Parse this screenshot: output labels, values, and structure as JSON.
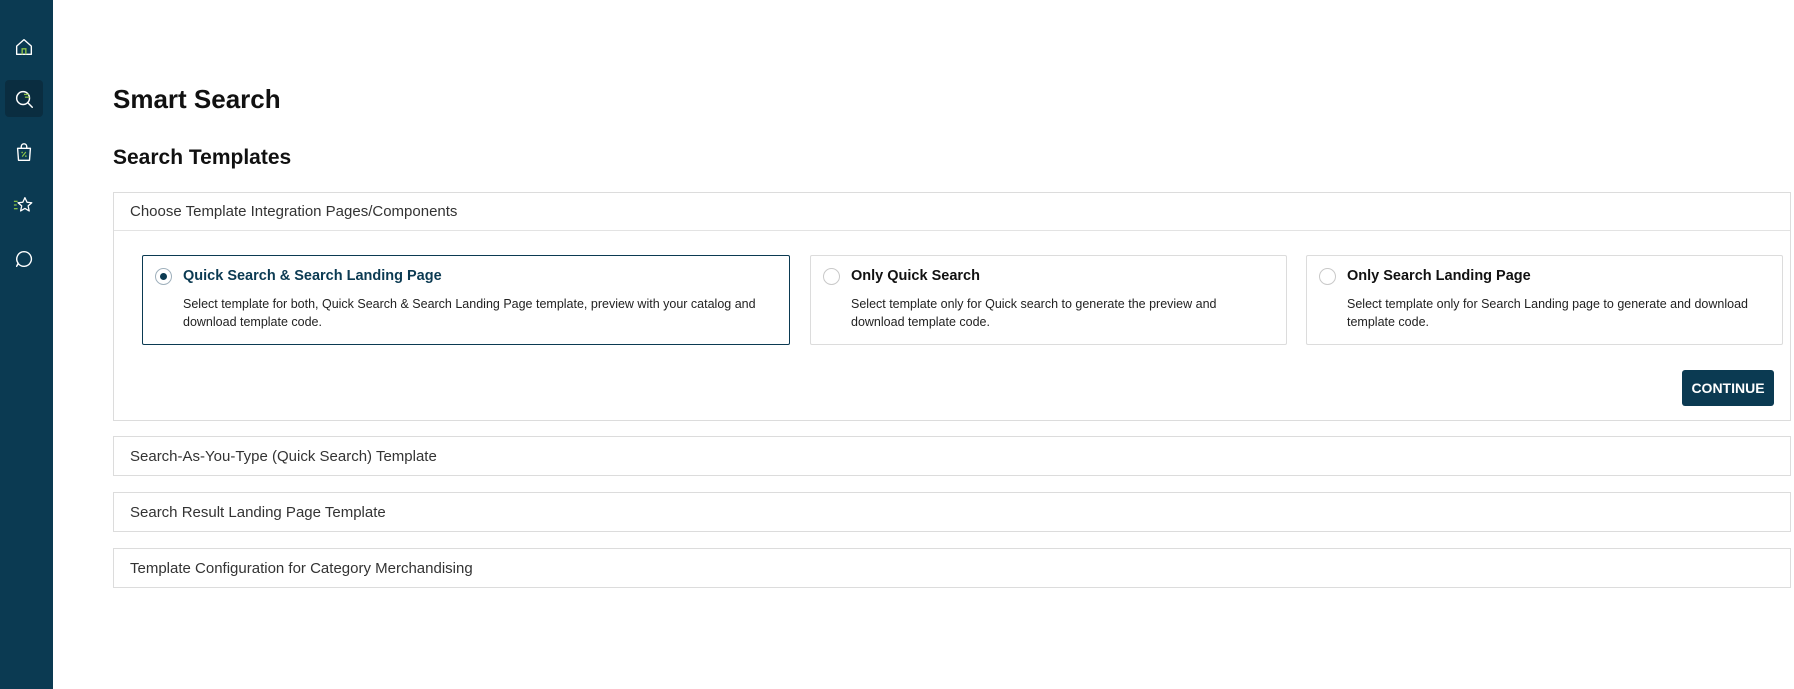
{
  "sidebar": {
    "items": [
      {
        "icon": "home-icon"
      },
      {
        "icon": "search-icon",
        "active": true
      },
      {
        "icon": "shopping-bag-icon"
      },
      {
        "icon": "star-icon"
      },
      {
        "icon": "chat-icon"
      }
    ]
  },
  "colors": {
    "sidebar_bg": "#0b3a52",
    "accent_green": "#8bc34a",
    "primary": "#0b3a52"
  },
  "header": {
    "page_title": "Smart Search",
    "section_title": "Search Templates"
  },
  "template_panel": {
    "header": "Choose Template Integration Pages/Components",
    "options": [
      {
        "title": "Quick Search & Search Landing Page",
        "description": "Select template for both, Quick Search & Search Landing Page template, preview with your catalog and download template code.",
        "selected": true
      },
      {
        "title": "Only Quick Search",
        "description": "Select template only for Quick search to generate the preview and download template code.",
        "selected": false
      },
      {
        "title": "Only Search Landing Page",
        "description": "Select template only for Search Landing page to generate and download template code.",
        "selected": false
      }
    ],
    "continue_label": "CONTINUE"
  },
  "collapsed_panels": [
    {
      "header": "Search-As-You-Type (Quick Search) Template"
    },
    {
      "header": "Search Result Landing Page Template"
    },
    {
      "header": "Template Configuration for Category Merchandising"
    }
  ]
}
